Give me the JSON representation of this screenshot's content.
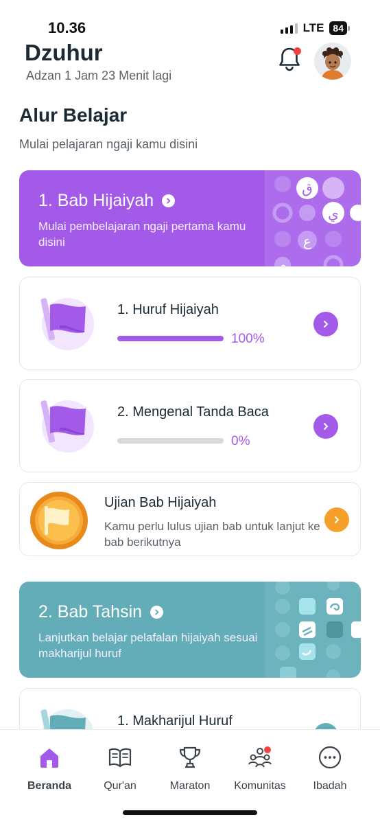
{
  "status_bar": {
    "time": "10.36",
    "network": "LTE",
    "battery": "84"
  },
  "header": {
    "prayer": "Dzuhur",
    "countdown": "Adzan 1 Jam 23 Menit lagi"
  },
  "section": {
    "title": "Alur Belajar",
    "subtitle": "Mulai pelajaran ngaji kamu disini"
  },
  "chapters": [
    {
      "title": "1. Bab Hijaiyah",
      "description": "Mulai pembelajaran ngaji pertama kamu disini",
      "color": "#a45ae8",
      "deco_letters": [
        "ق",
        "ي",
        "ع",
        "م"
      ]
    },
    {
      "title": "2. Bab Tahsin",
      "description": "Lanjutkan belajar pelafalan hijaiyah sesuai makharijul huruf",
      "color": "#62adb7"
    }
  ],
  "lessons": [
    {
      "title": "1. Huruf Hijaiyah",
      "progress": 100,
      "progress_label": "100%"
    },
    {
      "title": "2. Mengenal Tanda Baca",
      "progress": 0,
      "progress_label": "0%"
    }
  ],
  "exam": {
    "title": "Ujian Bab Hijaiyah",
    "description": "Kamu perlu lulus ujian bab untuk lanjut ke bab berikutnya",
    "accent": "#f5a02a"
  },
  "next_lesson": {
    "title": "1. Makharijul Huruf"
  },
  "bottom_nav": [
    {
      "label": "Beranda",
      "icon": "home-icon",
      "active": true
    },
    {
      "label": "Qur'an",
      "icon": "book-icon"
    },
    {
      "label": "Maraton",
      "icon": "trophy-icon"
    },
    {
      "label": "Komunitas",
      "icon": "community-icon",
      "badge": true
    },
    {
      "label": "Ibadah",
      "icon": "more-icon"
    }
  ]
}
